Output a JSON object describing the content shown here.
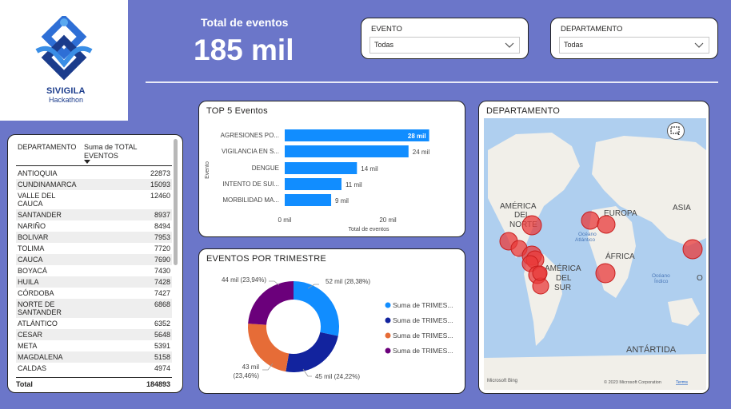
{
  "logo": {
    "name": "SIVIGILA",
    "subtitle": "Hackathon"
  },
  "kpi": {
    "label": "Total de eventos",
    "value": "185 mil"
  },
  "slicers": {
    "evento": {
      "label": "EVENTO",
      "value": "Todas"
    },
    "departamento": {
      "label": "DEPARTAMENTO",
      "value": "Todas"
    }
  },
  "table": {
    "col1": "DEPARTAMENTO",
    "col2": "Suma de TOTAL EVENTOS",
    "rows": [
      [
        "ANTIOQUIA",
        "22873"
      ],
      [
        "CUNDINAMARCA",
        "15093"
      ],
      [
        "VALLE DEL CAUCA",
        "12460"
      ],
      [
        "SANTANDER",
        "8937"
      ],
      [
        "NARIÑO",
        "8494"
      ],
      [
        "BOLIVAR",
        "7953"
      ],
      [
        "TOLIMA",
        "7720"
      ],
      [
        "CAUCA",
        "7690"
      ],
      [
        "BOYACÁ",
        "7430"
      ],
      [
        "HUILA",
        "7428"
      ],
      [
        "CÓRDOBA",
        "7427"
      ],
      [
        "NORTE DE SANTANDER",
        "6868"
      ],
      [
        "ATLÁNTICO",
        "6352"
      ],
      [
        "CESAR",
        "5648"
      ],
      [
        "META",
        "5391"
      ],
      [
        "MAGDALENA",
        "5158"
      ],
      [
        "CALDAS",
        "4974"
      ]
    ],
    "total_label": "Total",
    "total_value": "184893"
  },
  "top5": {
    "title": "TOP 5 Eventos",
    "y_axis_title": "Evento",
    "x_axis_title": "Total de eventos",
    "x_ticks": [
      "0 mil",
      "20 mil"
    ]
  },
  "trimestre": {
    "title": "EVENTOS POR TRIMESTRE",
    "legend": [
      "Suma de TRIMES...",
      "Suma de TRIMES...",
      "Suma de TRIMES...",
      "Suma de TRIMES..."
    ]
  },
  "map": {
    "title": "DEPARTAMENTO",
    "labels": [
      "AMÉRICA",
      "DEL",
      "NORTE",
      "EUROPA",
      "ASIA",
      "Océano",
      "Atlántico",
      "ÁFRICA",
      "AMÉRICA",
      "DEL",
      "SUR",
      "Océano",
      "Índico",
      "O",
      "ANTÁRTIDA"
    ],
    "footer_left": "Microsoft Bing",
    "footer_right": "© 2023 Microsoft Corporation",
    "footer_link": "Terms"
  },
  "colors": {
    "background": "#6B76C9",
    "bar": "#118DFF",
    "donut": [
      "#118DFF",
      "#12239E",
      "#E66C37",
      "#6B007B"
    ],
    "bubble": "#E8393A"
  },
  "chart_data": [
    {
      "type": "bar",
      "orientation": "horizontal",
      "title": "TOP 5 Eventos",
      "xlabel": "Total de eventos",
      "ylabel": "Evento",
      "categories": [
        "AGRESIONES PO...",
        "VIGILANCIA EN S...",
        "DENGUE",
        "INTENTO DE SUI...",
        "MORBILIDAD MA..."
      ],
      "values": [
        28,
        24,
        14,
        11,
        9
      ],
      "value_labels": [
        "28 mil",
        "24 mil",
        "14 mil",
        "11 mil",
        "9 mil"
      ],
      "xlim": [
        0,
        32
      ],
      "unit": "mil"
    },
    {
      "type": "pie",
      "donut": true,
      "title": "EVENTOS POR TRIMESTRE",
      "categories": [
        "Suma de TRIMES...",
        "Suma de TRIMES...",
        "Suma de TRIMES...",
        "Suma de TRIMES..."
      ],
      "values": [
        52,
        45,
        43,
        44
      ],
      "percents": [
        28.38,
        24.22,
        23.46,
        23.94
      ],
      "slice_labels": [
        "52 mil (28,38%)",
        "45 mil (24,22%)",
        "43 mil (23,46%)",
        "44 mil (23,94%)"
      ]
    }
  ]
}
